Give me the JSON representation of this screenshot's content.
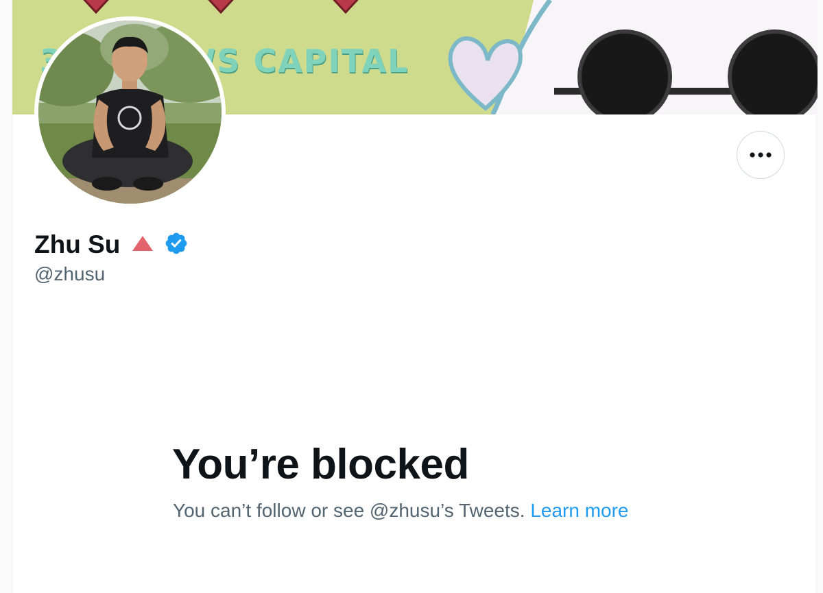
{
  "banner": {
    "text": "3 ARROWS CAPITAL"
  },
  "profile": {
    "display_name": "Zhu Su",
    "handle": "@zhusu",
    "icons": [
      "red-triangle-icon",
      "verified-badge-icon"
    ],
    "avatar": "profile-photo"
  },
  "actions": {
    "more_icon": "more-horizontal-icon"
  },
  "blocked": {
    "title": "You’re blocked",
    "description": "You can’t follow or see @zhusu’s Tweets.",
    "link_label": "Learn more"
  },
  "colors": {
    "banner_bg": "#cfdb8c",
    "banner_text": "#7fd3ba",
    "triangle": "#e0636e",
    "verified": "#1d9bf0",
    "link": "#1d9bf0",
    "primary_text": "#0f1419",
    "secondary_text": "#536471"
  }
}
